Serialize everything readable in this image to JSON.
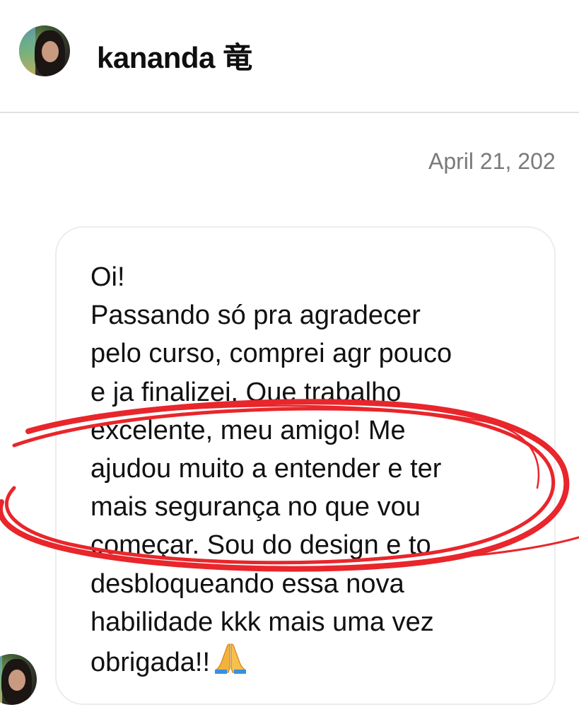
{
  "header": {
    "contact_name": "kananda 竜"
  },
  "conversation": {
    "date_separator": "April 21, 202",
    "message": {
      "lines": [
        "Oi!",
        "Passando só pra agradecer",
        "pelo curso, comprei agr pouco",
        "e ja finalizei. Que trabalho",
        "excelente, meu amigo! Me",
        "ajudou muito a entender e ter",
        "mais segurança no que vou",
        "começar. Sou do design e to",
        "desbloqueando essa nova",
        "habilidade kkk mais uma vez",
        "obrigada!!"
      ],
      "trailing_emoji": "folded-hands-emoji"
    }
  },
  "annotation": {
    "color": "#e8262b",
    "shape": "hand-drawn-ellipse"
  }
}
